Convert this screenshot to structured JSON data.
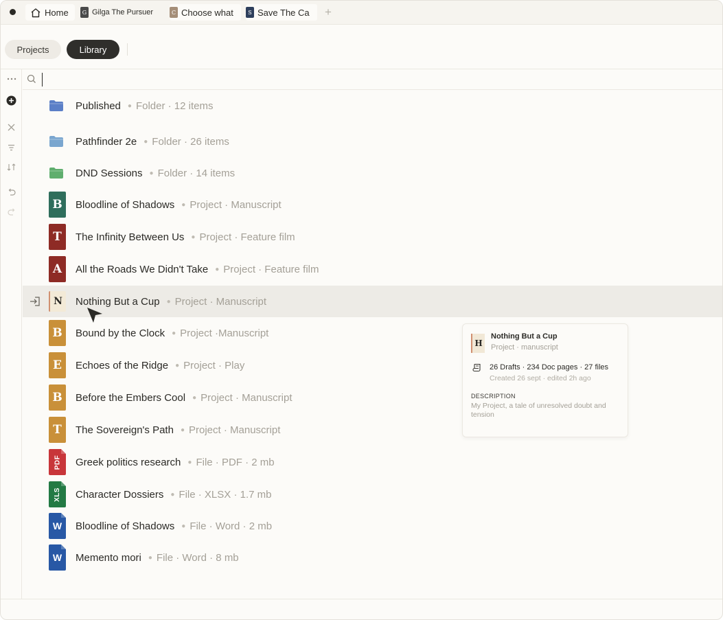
{
  "tabs": [
    {
      "label": "Home",
      "icon": "home-icon"
    },
    {
      "label": "Gilga The Pursuer",
      "thumb": "G",
      "thumb_color": "#4a4a4a"
    },
    {
      "label": "Choose what",
      "thumb": "C",
      "thumb_color": "#a58e78"
    },
    {
      "label": "Save The Ca",
      "thumb": "S",
      "thumb_color": "#2e3f5c"
    }
  ],
  "toolbar": {
    "projects_label": "Projects",
    "library_label": "Library"
  },
  "search": {
    "value": "",
    "placeholder": ""
  },
  "rows": [
    {
      "title": "Published",
      "meta": "Folder · 12 items",
      "kind": "folder",
      "color": "#5b7fc7"
    },
    {
      "title": "Pathfinder 2e",
      "meta": "Folder · 26 items",
      "kind": "folder",
      "color": "#7aa6cf"
    },
    {
      "title": "DND Sessions",
      "meta": "Folder · 14 items",
      "kind": "folder",
      "color": "#5fae6e"
    },
    {
      "title": "Bloodline of Shadows",
      "meta": "Project · Manuscript",
      "kind": "project",
      "letter": "B",
      "color": "#2f6e5c"
    },
    {
      "title": "The Infinity Between Us",
      "meta": "Project · Feature film",
      "kind": "project",
      "letter": "T",
      "color": "#8e2b25"
    },
    {
      "title": "All the Roads We Didn't Take",
      "meta": "Project · Feature film",
      "kind": "project",
      "letter": "A",
      "color": "#8e2b25"
    },
    {
      "title": "Nothing But a Cup",
      "meta": "Project · Manuscript",
      "kind": "selected",
      "letter": "N"
    },
    {
      "title": "Bound by the Clock",
      "meta": "Project ·Manuscript",
      "kind": "project",
      "letter": "B",
      "color": "#c99039"
    },
    {
      "title": "Echoes of the Ridge",
      "meta": "Project · Play",
      "kind": "project",
      "letter": "E",
      "color": "#c99039"
    },
    {
      "title": "Before the Embers Cool",
      "meta": "Project · Manuscript",
      "kind": "project",
      "letter": "B",
      "color": "#c99039"
    },
    {
      "title": "The Sovereign's Path",
      "meta": "Project · Manuscript",
      "kind": "project",
      "letter": "T",
      "color": "#c99039"
    },
    {
      "title": "Greek politics research",
      "meta": "File · PDF · 2 mb",
      "kind": "file",
      "badge": "PDF",
      "color": "#c8363a"
    },
    {
      "title": "Character Dossiers",
      "meta": "File · XLSX · 1.7 mb",
      "kind": "file",
      "badge": "XLS",
      "color": "#237a44"
    },
    {
      "title": "Bloodline of Shadows",
      "meta": "File · Word · 2 mb",
      "kind": "word",
      "badge": "W",
      "color": "#2858a5"
    },
    {
      "title": "Memento mori",
      "meta": "File · Word · 8 mb",
      "kind": "word",
      "badge": "W",
      "color": "#2858a5"
    }
  ],
  "card": {
    "letter": "H",
    "title": "Nothing But a Cup",
    "subtitle": "Project · manuscript",
    "stats": "26 Drafts · 234 Doc pages · 27 files",
    "dates": "Created 26 sept · edited 2h ago",
    "description_heading": "DESCRIPTION",
    "description": "My Project, a tale of unresolved doubt and tension"
  }
}
